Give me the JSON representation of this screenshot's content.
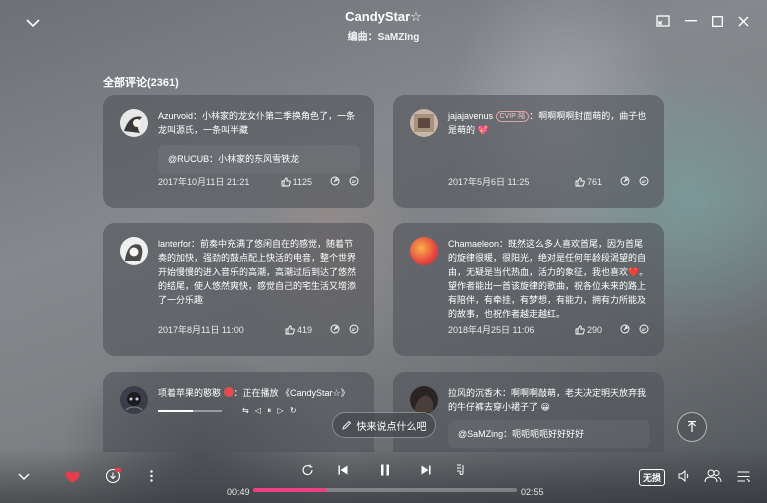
{
  "header": {
    "title": "CandyStar☆",
    "subtitle": "编曲：SaMZIng"
  },
  "comments_header": "全部评论(2361)",
  "comments": [
    {
      "user": "Azurvoid",
      "text": "：小林家的龙女仆第二季换角色了，一条龙叫源氏，一条叫半藏",
      "reply": "@RUCUB：小林家的东风雪铁龙",
      "date": "2017年10月11日 21:21",
      "likes": "1125"
    },
    {
      "user": "jajajavenus",
      "badge": "CVIP·陆",
      "text": "：啊啊啊啊封面萌的，曲子也是萌的",
      "emoji": "💖",
      "date": "2017年5月6日 11:25",
      "likes": "761"
    },
    {
      "user": "lanterfor",
      "text": "：前奏中充满了悠闲自在的感觉，随着节奏的加快，强劲的鼓点配上快活的电音，整个世界开始慢慢的进入音乐的高潮，高潮过后到达了悠然的结尾，使人悠然爽快，感觉自己的宅生活又增添了一分乐趣",
      "date": "2017年8月11日 11:00",
      "likes": "419"
    },
    {
      "user": "Chamaeleon",
      "text": "：既然这么多人喜欢首尾，因为首尾的旋律很暖，很阳光，绝对是任何年龄段渴望的自由，无疑是当代热血，活力的象征，我也喜欢",
      "emoji": "❤️",
      "text2": "。望作者能出一首该旋律的歌曲，祝各位未来的路上有陪伴，有牵挂，有梦想，有能力，拥有力所能及的故事，也祝作者越走越红。",
      "date": "2018年4月25日 11:06",
      "likes": "290"
    },
    {
      "user": "项着苹果的憨憨",
      "text": "：正在播放 《CandyStar☆》"
    },
    {
      "user": "拉风的沉香木",
      "text": "：啊啊啊敲萌，老夫决定明天放弃我的牛仔裤去穿小裙子了",
      "emoji": "😀",
      "reply": "@SaMZing：呃呃呃呃好好好好"
    }
  ],
  "compose_label": "快来说点什么吧",
  "player": {
    "current_time": "00:49",
    "total_time": "02:55",
    "progress": 0.28,
    "quality": "无损"
  },
  "colors": {
    "accent": "#ec4182",
    "heart": "#e83c4a"
  }
}
